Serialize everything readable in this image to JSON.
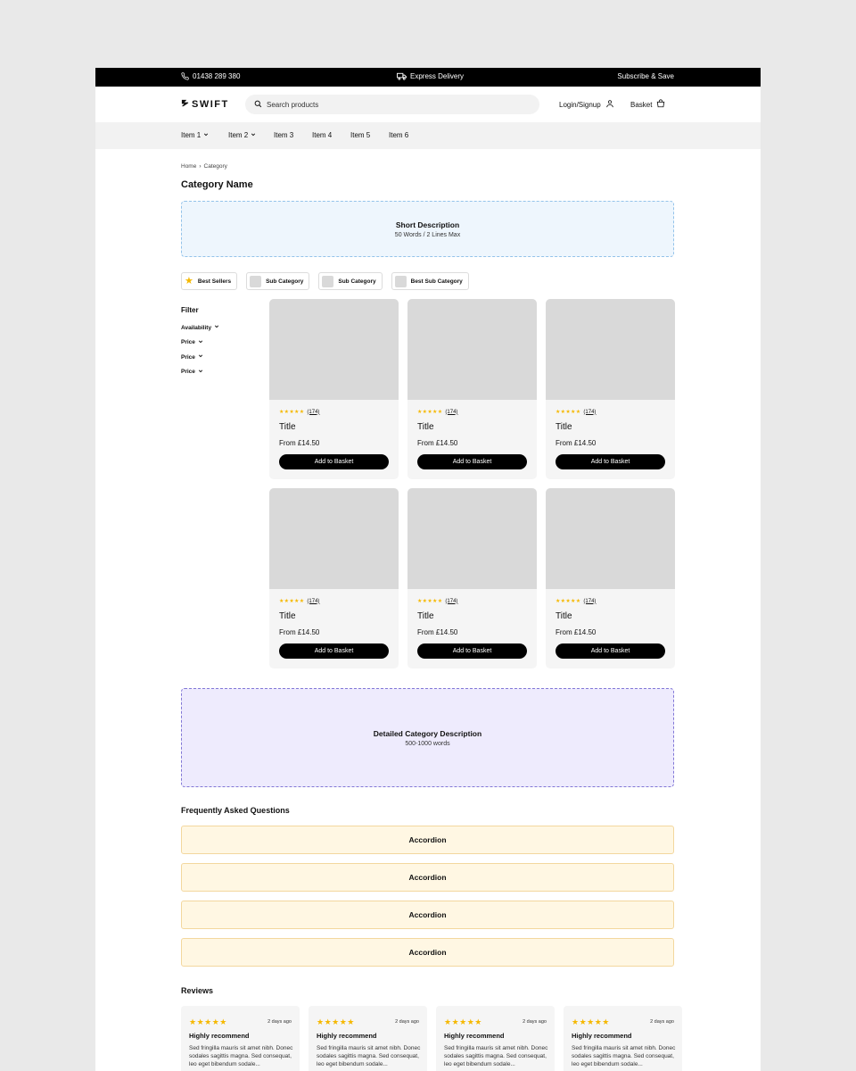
{
  "topbar": {
    "phone": "01438 289 380",
    "delivery": "Express Delivery",
    "subscribe": "Subscribe & Save"
  },
  "header": {
    "logo": "SWIFT",
    "search_placeholder": "Search products",
    "login": "Login/Signup",
    "basket": "Basket"
  },
  "nav": {
    "items": [
      {
        "label": "Item 1",
        "dropdown": true
      },
      {
        "label": "Item 2",
        "dropdown": true
      },
      {
        "label": "Item 3",
        "dropdown": false
      },
      {
        "label": "Item 4",
        "dropdown": false
      },
      {
        "label": "Item 5",
        "dropdown": false
      },
      {
        "label": "Item 6",
        "dropdown": false
      }
    ]
  },
  "breadcrumb": {
    "home": "Home",
    "separator": "›",
    "current": "Category"
  },
  "category": {
    "title": "Category Name",
    "short_desc_title": "Short Description",
    "short_desc_sub": "50 Words / 2 Lines Max"
  },
  "chips": [
    {
      "label": "Best Sellers",
      "icon": "star-icon"
    },
    {
      "label": "Sub Category",
      "icon": "thumbnail"
    },
    {
      "label": "Sub Category",
      "icon": "thumbnail"
    },
    {
      "label": "Best Sub Category",
      "icon": "thumbnail"
    }
  ],
  "filter": {
    "title": "Filter",
    "items": [
      "Availability",
      "Price",
      "Price",
      "Price"
    ]
  },
  "products": [
    {
      "stars": "★★★★★",
      "reviews": "(174)",
      "title": "Title",
      "price": "From £14.50",
      "button": "Add to Basket"
    },
    {
      "stars": "★★★★★",
      "reviews": "(174)",
      "title": "Title",
      "price": "From £14.50",
      "button": "Add to Basket"
    },
    {
      "stars": "★★★★★",
      "reviews": "(174)",
      "title": "Title",
      "price": "From £14.50",
      "button": "Add to Basket"
    },
    {
      "stars": "★★★★★",
      "reviews": "(174)",
      "title": "Title",
      "price": "From £14.50",
      "button": "Add to Basket"
    },
    {
      "stars": "★★★★★",
      "reviews": "(174)",
      "title": "Title",
      "price": "From £14.50",
      "button": "Add to Basket"
    },
    {
      "stars": "★★★★★",
      "reviews": "(174)",
      "title": "Title",
      "price": "From £14.50",
      "button": "Add to Basket"
    }
  ],
  "detailed": {
    "title": "Detailed Category Description",
    "sub": "500-1000 words"
  },
  "faq": {
    "title": "Frequently Asked Questions",
    "items": [
      "Accordion",
      "Accordion",
      "Accordion",
      "Accordion"
    ]
  },
  "reviews": {
    "title": "Reviews",
    "items": [
      {
        "stars": "★★★★★",
        "date": "2 days ago",
        "heading": "Highly recommend",
        "text": "Sed fringilla mauris sit amet nibh. Donec sodales sagittis magna. Sed consequat, leo eget bibendum sodale..."
      },
      {
        "stars": "★★★★★",
        "date": "2 days ago",
        "heading": "Highly recommend",
        "text": "Sed fringilla mauris sit amet nibh. Donec sodales sagittis magna. Sed consequat, leo eget bibendum sodale..."
      },
      {
        "stars": "★★★★★",
        "date": "2 days ago",
        "heading": "Highly recommend",
        "text": "Sed fringilla mauris sit amet nibh. Donec sodales sagittis magna. Sed consequat, leo eget bibendum sodale..."
      },
      {
        "stars": "★★★★★",
        "date": "2 days ago",
        "heading": "Highly recommend",
        "text": "Sed fringilla mauris sit amet nibh. Donec sodales sagittis magna. Sed consequat, leo eget bibendum sodale..."
      }
    ]
  },
  "colors": {
    "star": "#f5b800",
    "short_desc_bg": "#eef6fd",
    "detailed_bg": "#eeebfd",
    "accordion_bg": "#fff7e3"
  }
}
